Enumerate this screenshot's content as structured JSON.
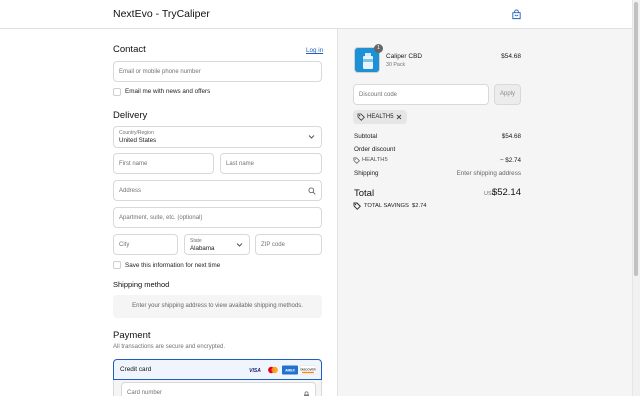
{
  "header": {
    "brand": "NextEvo - TryCaliper",
    "bag_icon": "shopping-bag-icon"
  },
  "contact": {
    "title": "Contact",
    "login_link": "Log in",
    "email_placeholder": "Email or mobile phone number",
    "newsletter_label": "Email me with news and offers"
  },
  "delivery": {
    "title": "Delivery",
    "country_label": "Country/Region",
    "country_value": "United States",
    "first_name_placeholder": "First name",
    "last_name_placeholder": "Last name",
    "address_placeholder": "Address",
    "apartment_placeholder": "Apartment, suite, etc. (optional)",
    "city_placeholder": "City",
    "state_label": "State",
    "state_value": "Alabama",
    "zip_placeholder": "ZIP code",
    "save_info_label": "Save this information for next time"
  },
  "shipping_method": {
    "title": "Shipping method",
    "message": "Enter your shipping address to view available shipping methods."
  },
  "payment": {
    "title": "Payment",
    "subtitle": "All transactions are secure and encrypted.",
    "credit_card_label": "Credit card",
    "card_brands": [
      "VISA",
      "mastercard",
      "AMEX",
      "DISCOVER"
    ],
    "card_number_placeholder": "Card number"
  },
  "summary": {
    "product": {
      "name": "Caliper CBD",
      "variant": "30 Pack",
      "price": "$54.68",
      "quantity": "1"
    },
    "discount_placeholder": "Discount code",
    "apply_label": "Apply",
    "applied_code": "HEALTH5",
    "subtotal_label": "Subtotal",
    "subtotal_value": "$54.68",
    "order_discount_label": "Order discount",
    "discount_code": "HEALTH5",
    "discount_value": "− $2.74",
    "shipping_label": "Shipping",
    "shipping_value": "Enter shipping address",
    "total_label": "Total",
    "currency": "USD",
    "total_value": "$52.14",
    "savings_label": "TOTAL SAVINGS",
    "savings_value": "$2.74"
  },
  "colors": {
    "accent": "#1f5fbf",
    "panel": "#f5f5f5",
    "product_blue": "#1e90d6"
  }
}
